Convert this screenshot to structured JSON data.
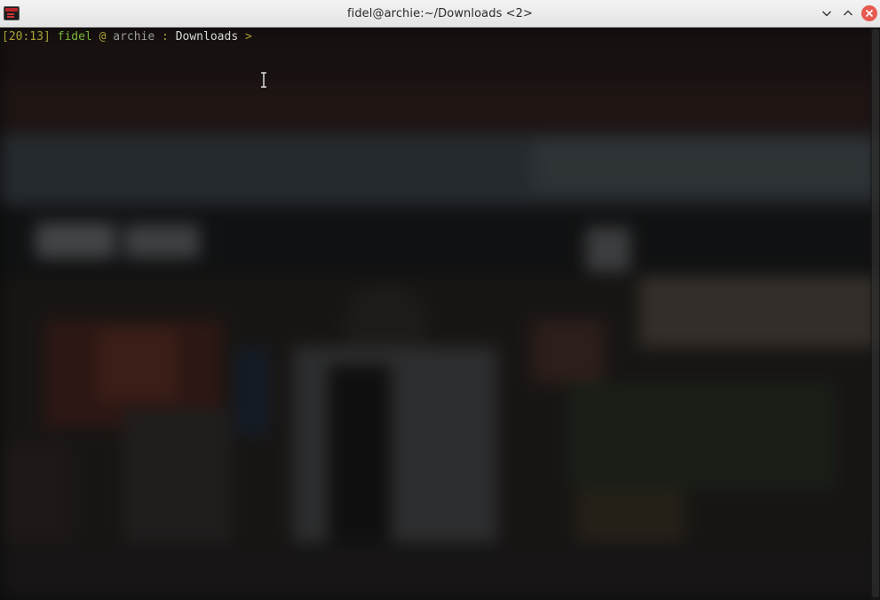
{
  "window": {
    "title": "fidel@archie:~/Downloads <2>",
    "icon": "terminal-app-icon",
    "buttons": {
      "minimize": "chevron-down-icon",
      "maximize": "chevron-up-icon",
      "close": "close-icon"
    },
    "colors": {
      "titlebar": "#e8e8e8",
      "close_button": "#e85a4f"
    }
  },
  "terminal": {
    "prompt": {
      "time": "[20:13]",
      "user": "fidel",
      "at": "@",
      "host": "archie",
      "separator": ":",
      "directory": "Downloads",
      "symbol": ">"
    },
    "colors": {
      "time": "#a8a032",
      "user": "#7ab53a",
      "at": "#a8a032",
      "host": "#9a9a9a",
      "separator": "#a8a032",
      "directory": "#d8d8d8",
      "symbol": "#a8a032"
    }
  }
}
